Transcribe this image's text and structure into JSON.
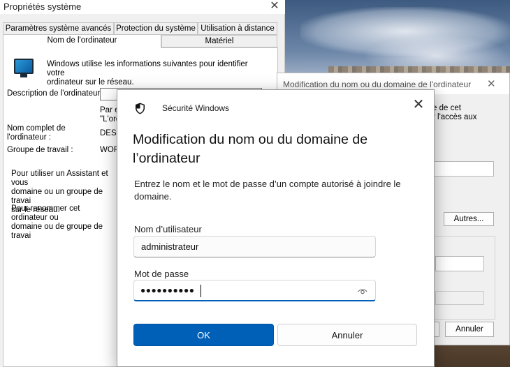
{
  "system_properties": {
    "title": "Propriétés système",
    "tabs": {
      "advanced": "Paramètres système avancés",
      "protection": "Protection du système",
      "remote": "Utilisation à distance",
      "computer_name": "Nom de l'ordinateur",
      "hardware": "Matériel"
    },
    "intro": "Windows utilise les informations suivantes pour identifier votre\nordinateur sur le réseau.",
    "description_label": "Description de l'ordinateur :",
    "description_hint": "Par e\n\"L'ord",
    "full_name_label": "Nom complet de\nl'ordinateur :",
    "full_name_value": "DESI",
    "workgroup_label": "Groupe de travail :",
    "workgroup_value": "WOR",
    "assistant_text": "Pour utiliser un Assistant et vous\ndomaine ou un groupe de travai\nsur le réseau.",
    "rename_text": "Pour renommer cet ordinateur ou\ndomaine ou de groupe de travai"
  },
  "background_dialog": {
    "title": "Modification du nom ou du domaine de l'ordinateur",
    "partial_text": "e de cet\nr l'accès aux",
    "others_button": "Autres...",
    "cancel_button": "Annuler"
  },
  "security_dialog": {
    "app_title": "Sécurité Windows",
    "heading": "Modification du nom ou du domaine de l’ordinateur",
    "instructions": "Entrez le nom et le mot de passe d’un compte autorisé à joindre le domaine.",
    "username_label": "Nom d’utilisateur",
    "username_value": "administrateur",
    "password_label": "Mot de passe",
    "password_mask": "●●●●●●●●●●",
    "ok_button": "OK",
    "cancel_button": "Annuler",
    "accent_color": "#0060b8"
  },
  "icons": {
    "window_close": "close-icon",
    "security": "shield-icon",
    "computer": "monitor-icon",
    "reveal_password": "eye-icon"
  }
}
